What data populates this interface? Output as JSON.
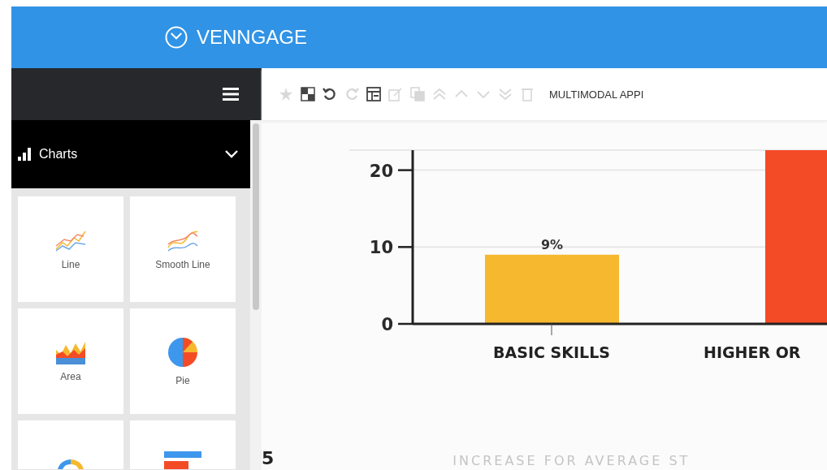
{
  "header": {
    "logo": "VENNGAGE"
  },
  "sidebar": {
    "section": {
      "label": "Charts",
      "expanded": true
    },
    "tiles": [
      {
        "kind": "line",
        "label": "Line"
      },
      {
        "kind": "smooth",
        "label": "Smooth Line"
      },
      {
        "kind": "area",
        "label": "Area"
      },
      {
        "kind": "pie",
        "label": "Pie"
      },
      {
        "kind": "donut"
      },
      {
        "kind": "bar"
      }
    ]
  },
  "toolbar": {
    "tools": [
      {
        "kind": "star",
        "disabled": true
      },
      {
        "kind": "checker",
        "disabled": false
      },
      {
        "kind": "undo",
        "disabled": false
      },
      {
        "kind": "redo",
        "disabled": true
      },
      {
        "kind": "layout",
        "disabled": false
      },
      {
        "kind": "edit",
        "disabled": true
      },
      {
        "kind": "copy",
        "disabled": true
      },
      {
        "kind": "top",
        "disabled": true
      },
      {
        "kind": "up",
        "disabled": true
      },
      {
        "kind": "down",
        "disabled": true
      },
      {
        "kind": "bottom",
        "disabled": true
      },
      {
        "kind": "trash",
        "disabled": true
      }
    ],
    "document_title": "MULTIMODAL APPI"
  },
  "canvas": {
    "chart_data": {
      "type": "bar",
      "categories": [
        "BASIC SKILLS",
        "HIGHER OR"
      ],
      "series": [
        {
          "color": "#f5b82e",
          "values": [
            9,
            null
          ]
        },
        {
          "color": "#f44b27",
          "values": [
            null,
            22.6
          ]
        }
      ],
      "ylim": [
        0,
        22.6
      ],
      "yticks": [
        0,
        10,
        20
      ],
      "value_labels": [
        "9%",
        null
      ]
    },
    "side_text": "5",
    "caption": "INCREASE FOR AVERAGE ST"
  }
}
